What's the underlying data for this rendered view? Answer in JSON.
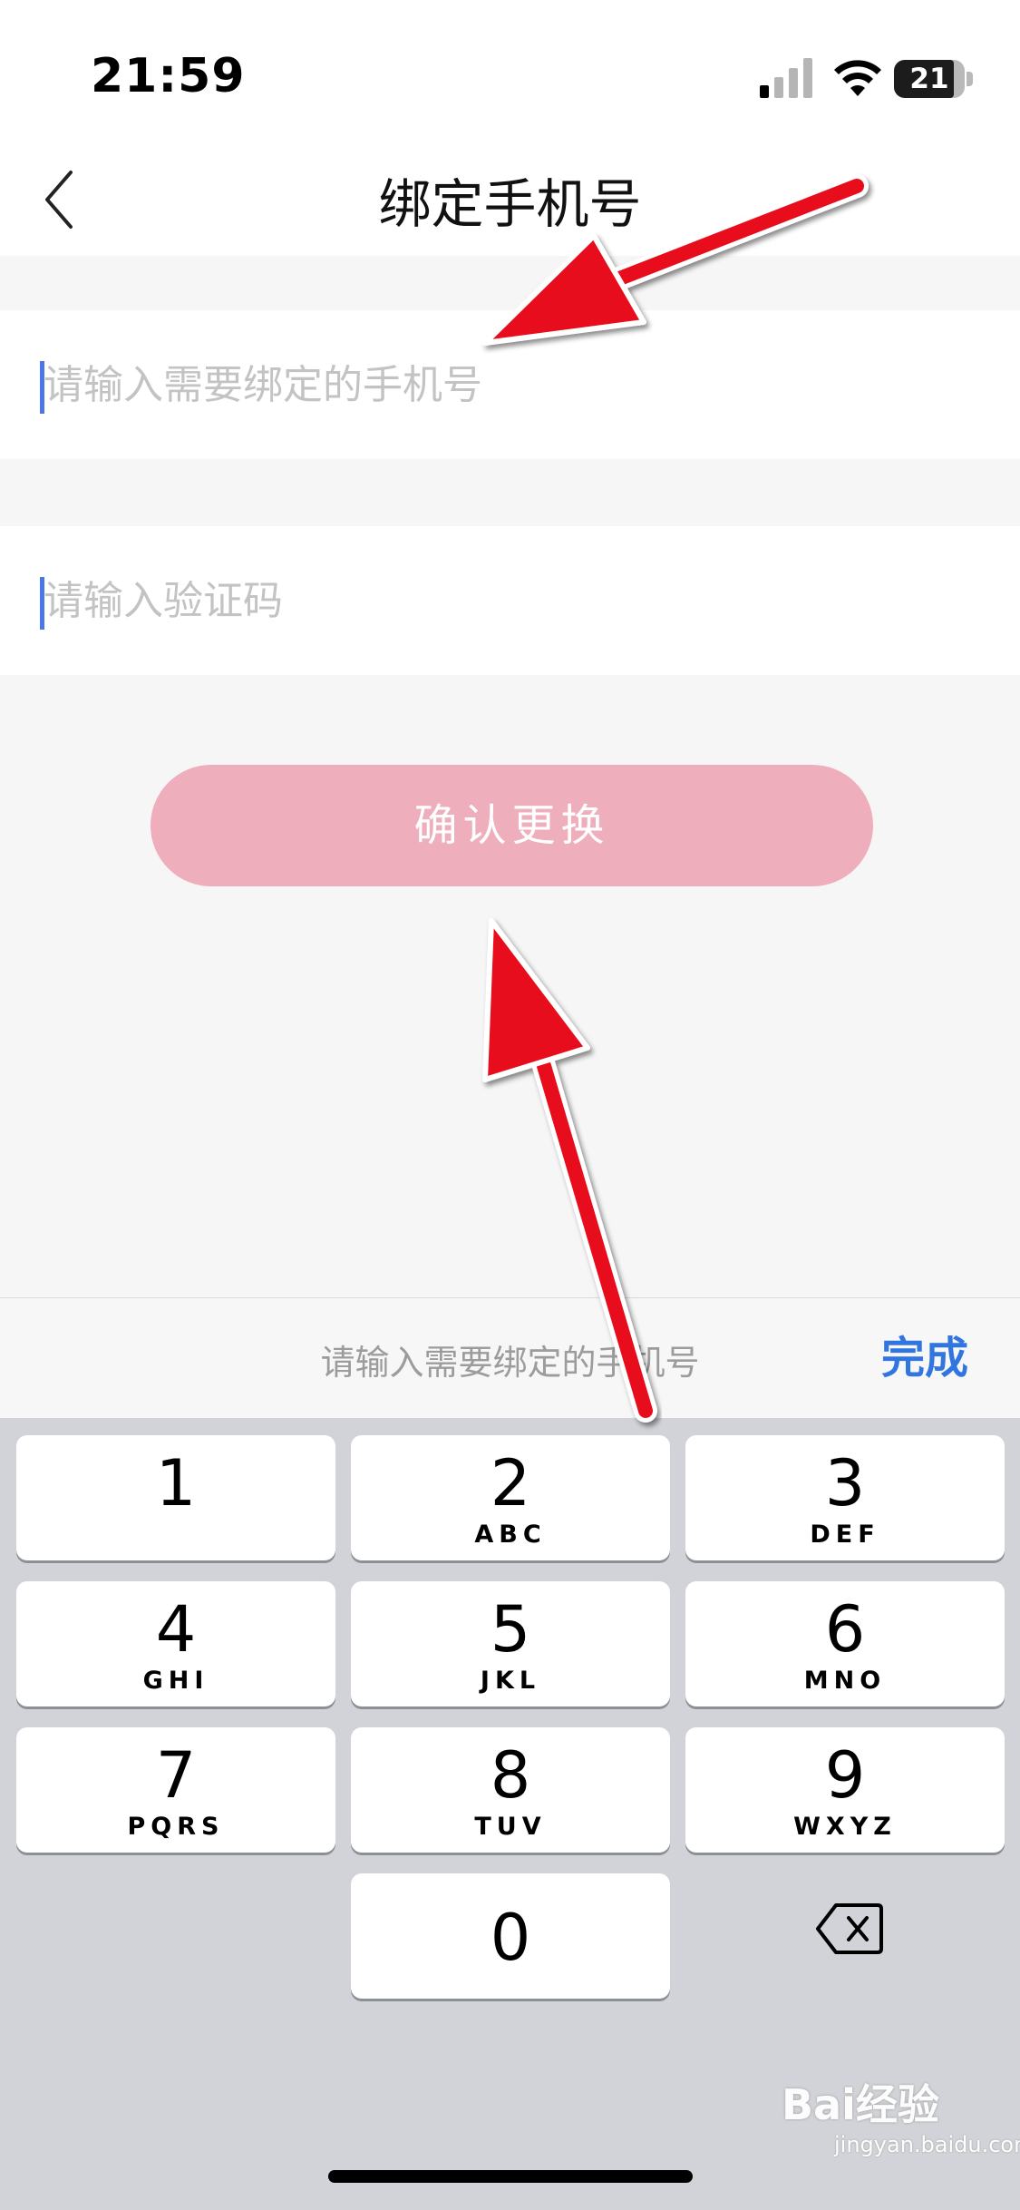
{
  "status_bar": {
    "time": "21:59",
    "battery": "21"
  },
  "header": {
    "title": "绑定手机号"
  },
  "form": {
    "phone_placeholder": "请输入需要绑定的手机号",
    "code_placeholder": "请输入验证码",
    "confirm_label": "确认更换"
  },
  "keyboard": {
    "hint": "请输入需要绑定的手机号",
    "done_label": "完成",
    "keys": [
      {
        "num": "1",
        "letters": ""
      },
      {
        "num": "2",
        "letters": "ABC"
      },
      {
        "num": "3",
        "letters": "DEF"
      },
      {
        "num": "4",
        "letters": "GHI"
      },
      {
        "num": "5",
        "letters": "JKL"
      },
      {
        "num": "6",
        "letters": "MNO"
      },
      {
        "num": "7",
        "letters": "PQRS"
      },
      {
        "num": "8",
        "letters": "TUV"
      },
      {
        "num": "9",
        "letters": "WXYZ"
      },
      {
        "num": "0",
        "letters": ""
      }
    ]
  },
  "watermark": {
    "brand": "Bai经验",
    "url": "jingyan.baidu.com"
  },
  "colors": {
    "accent": "#3176e0",
    "button": "#efaebb",
    "arrow": "#e8101a"
  }
}
